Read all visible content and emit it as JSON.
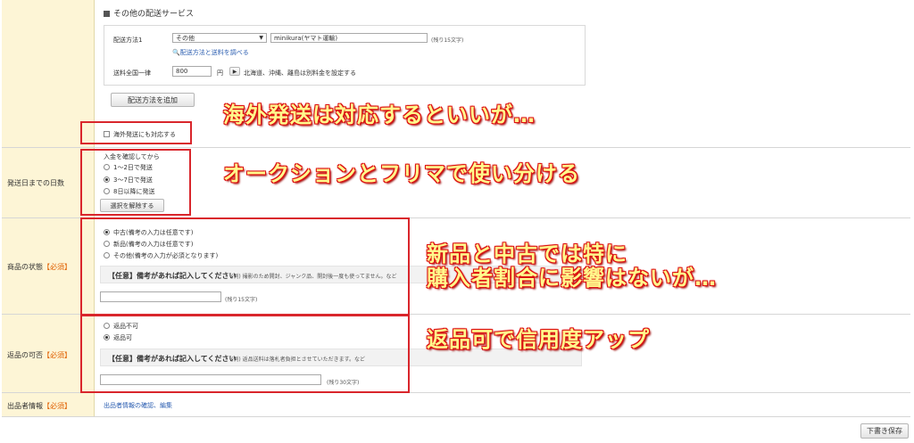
{
  "delivery": {
    "other_service_label": "その他の配送サービス",
    "method_label": "配送方法1",
    "method_select": "その他",
    "method_input": "minikura(ヤマト運輸)",
    "method_remaining": "(残り15文字)",
    "lookup_link": "配送方法と送料を調べる",
    "flat_rate_label": "送料全国一律",
    "flat_rate_value": "800",
    "yen": "円",
    "remote_note": "北海道、沖縄、離島は別料金を設定する",
    "add_method_button": "配送方法を追加",
    "overseas_label": "海外発送にも対応する"
  },
  "shipping_days": {
    "label": "発送日までの日数",
    "header": "入金を確認してから",
    "options": [
      "1～2日で発送",
      "3～7日で発送",
      "8日以降に発送"
    ],
    "clear_button": "選択を解除する"
  },
  "condition": {
    "label": "商品の状態",
    "required": "【必須】",
    "options": [
      "中古(備考の入力は任意です)",
      "新品(備考の入力は任意です)",
      "その他(備考の入力が必須となります)"
    ],
    "remark_title": "【任意】備考があれば記入してください",
    "remark_example": "(例) 撮影のため開封、ジャンク品、開封後一度も使ってません。など",
    "remaining": "(残り15文字)"
  },
  "returns": {
    "label": "返品の可否",
    "required": "【必須】",
    "options": [
      "返品不可",
      "返品可"
    ],
    "remark_title": "【任意】備考があれば記入してください",
    "remark_example": "(例) 返品送料は落札者負担とさせていただきます。など",
    "remaining": "(残り30文字)"
  },
  "seller": {
    "label": "出品者情報",
    "required": "【必須】",
    "link": "出品者情報の確認、編集"
  },
  "draft_button": "下書き保存",
  "annotations": {
    "overseas": "海外発送は対応するといいが…",
    "days": "オークションとフリマで使い分ける",
    "condition_line1": "新品と中古では特に",
    "condition_line2": "購入者割合に影響はないが…",
    "returns": "返品可で信用度アップ"
  },
  "colors": {
    "label_bg": "#fdf5d6",
    "highlight_red": "#d9262c",
    "annotation_fill": "#fffa8c",
    "link_blue": "#2a5db0",
    "required_orange": "#e06000"
  }
}
